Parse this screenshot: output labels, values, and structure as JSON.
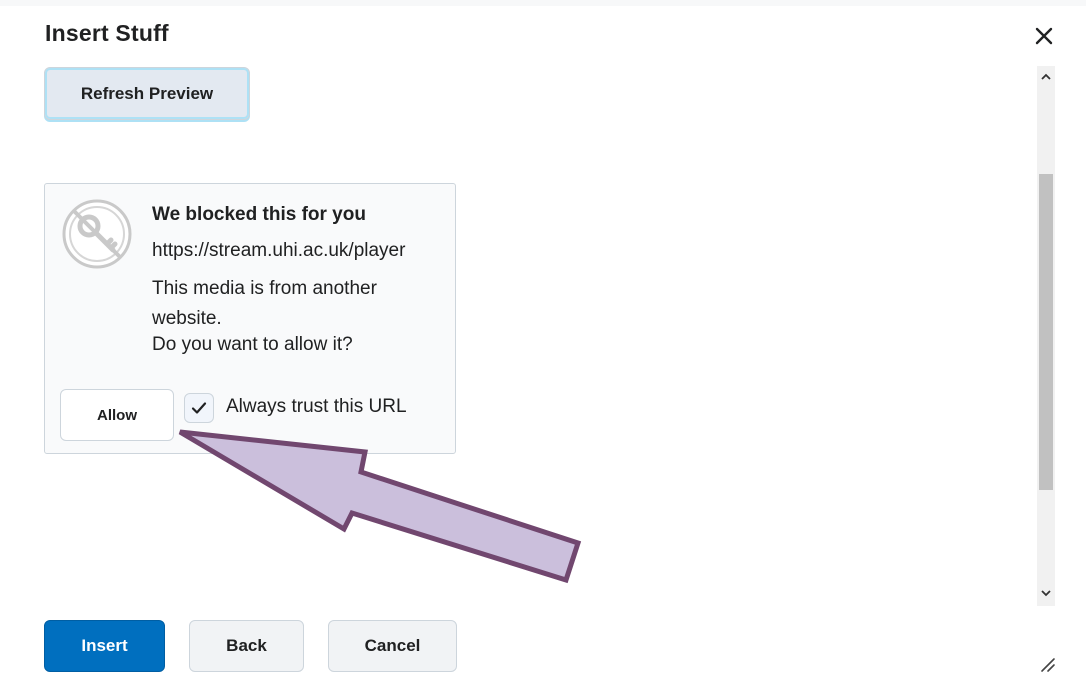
{
  "dialog": {
    "title": "Insert Stuff",
    "close_icon": "close-icon"
  },
  "preview": {
    "refresh_label": "Refresh Preview"
  },
  "blocked_media": {
    "icon": "blocked-key-icon",
    "title": "We blocked this for you",
    "url": "https://stream.uhi.ac.uk/player",
    "message": "This media is from another website.",
    "question": "Do you want to allow it?",
    "allow_label": "Allow",
    "trust_label": "Always trust this URL",
    "trust_checked": true
  },
  "annotation": {
    "arrow_color": "#cbbfdc",
    "arrow_outline": "#71476f"
  },
  "footer": {
    "insert_label": "Insert",
    "back_label": "Back",
    "cancel_label": "Cancel"
  },
  "colors": {
    "primary": "#006fbf",
    "border": "#cdd5dc",
    "focus_ring": "#aee1f5"
  }
}
